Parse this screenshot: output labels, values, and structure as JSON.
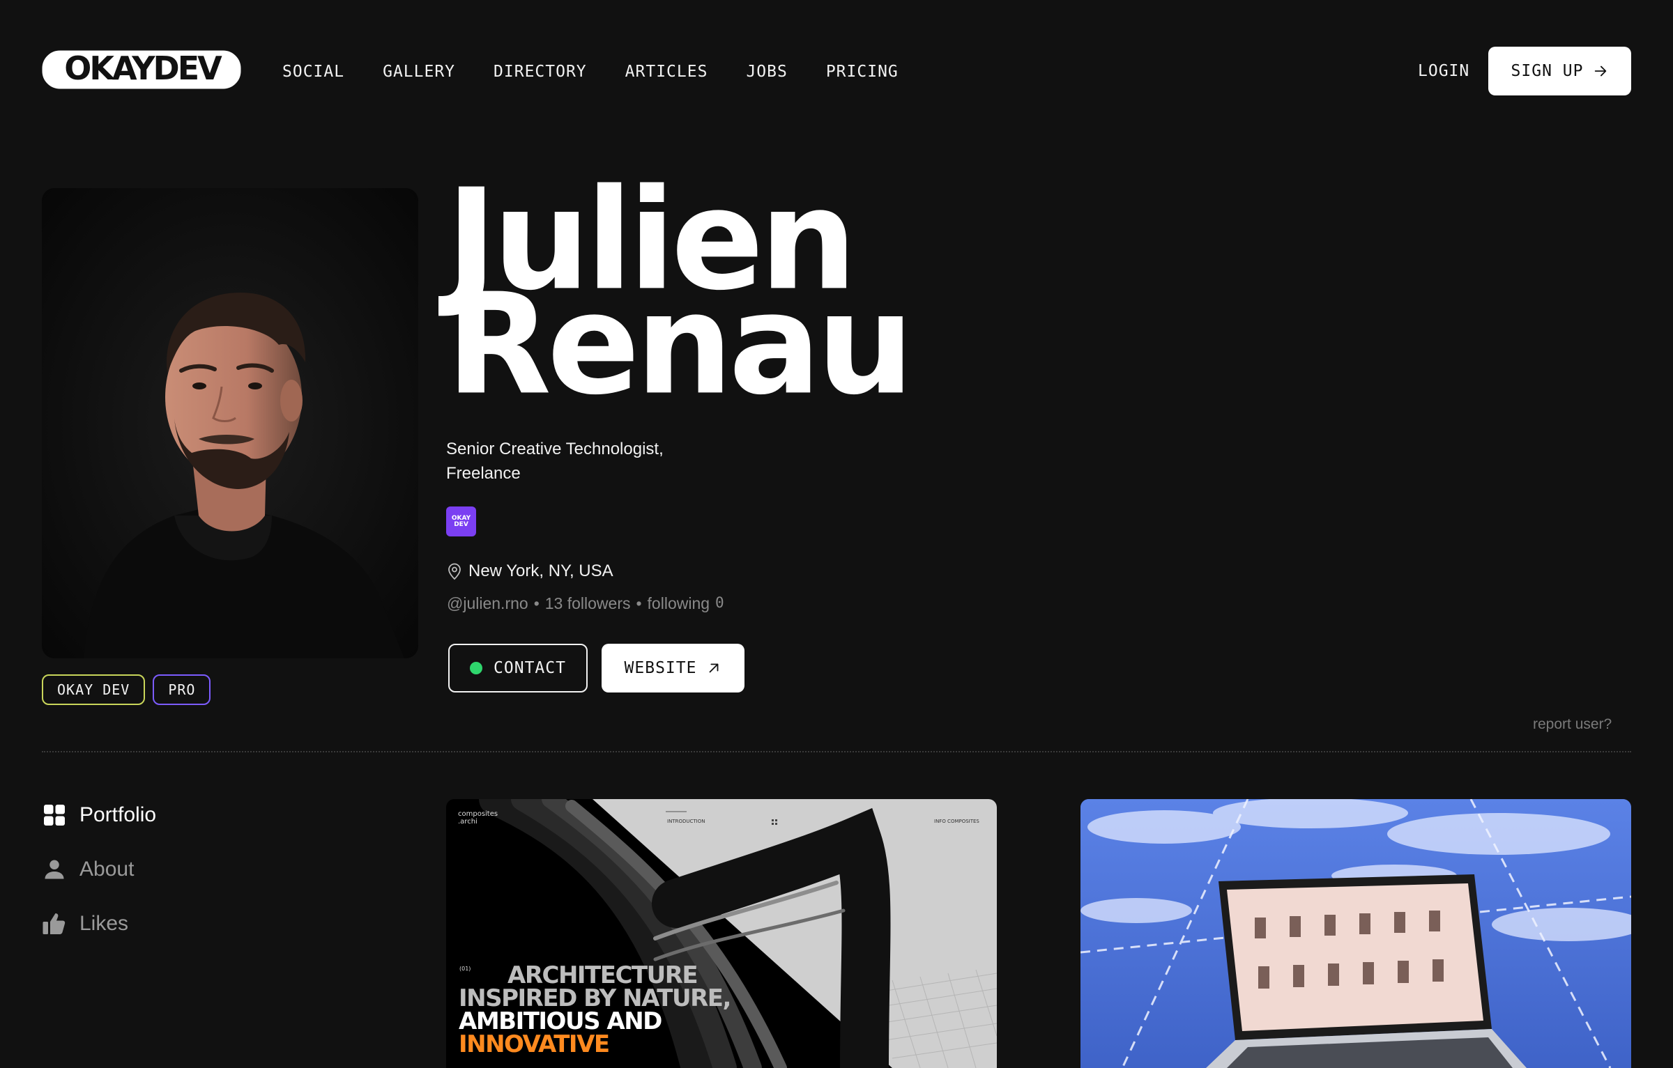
{
  "header": {
    "logo_text": "OKAYDEV",
    "nav": [
      "SOCIAL",
      "GALLERY",
      "DIRECTORY",
      "ARTICLES",
      "JOBS",
      "PRICING"
    ],
    "login_label": "LOGIN",
    "signup_label": "SIGN UP"
  },
  "profile": {
    "first_name": "Julien",
    "last_name": "Renau",
    "title_line1": "Senior Creative Technologist,",
    "title_line2": "Freelance",
    "org_logo_text": "OKAY DEV",
    "location": "New York, NY, USA",
    "handle": "@julien.rno",
    "followers": "13 followers",
    "following_label": "following",
    "following_count": "0",
    "separator": "•",
    "badges": [
      "OKAY DEV",
      "PRO"
    ],
    "contact_label": "CONTACT",
    "website_label": "WEBSITE",
    "report_label": "report user?"
  },
  "tabs": [
    {
      "label": "Portfolio",
      "icon": "grid-icon"
    },
    {
      "label": "About",
      "icon": "user-icon"
    },
    {
      "label": "Likes",
      "icon": "thumbs-up-icon"
    }
  ],
  "portfolio": {
    "card1": {
      "brand_line1": "composites",
      "brand_line2": ".archi",
      "nav_intro": "INTRODUCTION",
      "nav_right": "INFO COMPOSITES",
      "index": "(01)",
      "headline": [
        "ARCHITECTURE",
        "INSPIRED BY NATURE,",
        "AMBITIOUS AND",
        "INNOVATIVE"
      ]
    }
  },
  "colors": {
    "background": "#111111",
    "contact_dot": "#2fd66d",
    "badge_okay_border": "#c9d65a",
    "badge_pro_border": "#7c5cff",
    "org_logo": "#7b3ff2",
    "headline_accent": "#ff8a1f"
  }
}
